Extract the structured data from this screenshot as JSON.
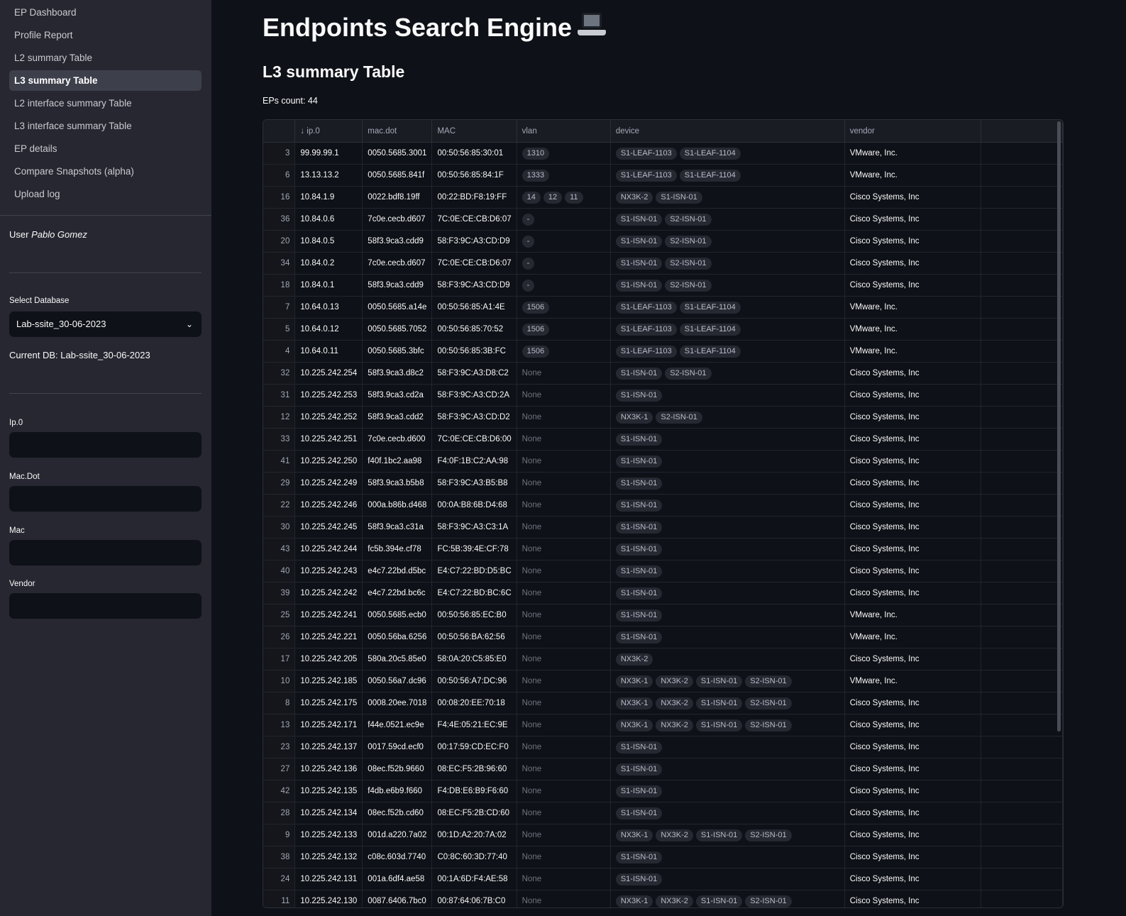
{
  "sidebar": {
    "nav": [
      {
        "label": "EP Dashboard",
        "active": false
      },
      {
        "label": "Profile Report",
        "active": false
      },
      {
        "label": "L2 summary Table",
        "active": false
      },
      {
        "label": "L3 summary Table",
        "active": true
      },
      {
        "label": "L2 interface summary Table",
        "active": false
      },
      {
        "label": "L3 interface summary Table",
        "active": false
      },
      {
        "label": "EP details",
        "active": false
      },
      {
        "label": "Compare Snapshots (alpha)",
        "active": false
      },
      {
        "label": "Upload log",
        "active": false
      }
    ],
    "user_prefix": "User ",
    "user_name": "Pablo Gomez",
    "select_db_label": "Select Database",
    "select_db_value": "Lab-ssite_30-06-2023",
    "current_db": "Current DB: Lab-ssite_30-06-2023",
    "filters": {
      "ip_label": "Ip.0",
      "macdot_label": "Mac.Dot",
      "mac_label": "Mac",
      "vendor_label": "Vendor"
    }
  },
  "main": {
    "title": "Endpoints Search Engine",
    "subtitle": "L3 summary Table",
    "count": "EPs count: 44"
  },
  "table": {
    "columns": [
      "",
      "↓ ip.0",
      "mac.dot",
      "MAC",
      "vlan",
      "device",
      "vendor",
      ""
    ],
    "rows": [
      {
        "idx": "3",
        "ip": "99.99.99.1",
        "macdot": "0050.5685.3001",
        "mac": "00:50:56:85:30:01",
        "vlan": [
          "1310"
        ],
        "device": [
          "S1-LEAF-1103",
          "S1-LEAF-1104"
        ],
        "vendor": "VMware, Inc."
      },
      {
        "idx": "6",
        "ip": "13.13.13.2",
        "macdot": "0050.5685.841f",
        "mac": "00:50:56:85:84:1F",
        "vlan": [
          "1333"
        ],
        "device": [
          "S1-LEAF-1103",
          "S1-LEAF-1104"
        ],
        "vendor": "VMware, Inc."
      },
      {
        "idx": "16",
        "ip": "10.84.1.9",
        "macdot": "0022.bdf8.19ff",
        "mac": "00:22:BD:F8:19:FF",
        "vlan": [
          "14",
          "12",
          "11"
        ],
        "device": [
          "NX3K-2",
          "S1-ISN-01"
        ],
        "vendor": "Cisco Systems, Inc"
      },
      {
        "idx": "36",
        "ip": "10.84.0.6",
        "macdot": "7c0e.cecb.d607",
        "mac": "7C:0E:CE:CB:D6:07",
        "vlan": [
          "-"
        ],
        "device": [
          "S1-ISN-01",
          "S2-ISN-01"
        ],
        "vendor": "Cisco Systems, Inc"
      },
      {
        "idx": "20",
        "ip": "10.84.0.5",
        "macdot": "58f3.9ca3.cdd9",
        "mac": "58:F3:9C:A3:CD:D9",
        "vlan": [
          "-"
        ],
        "device": [
          "S1-ISN-01",
          "S2-ISN-01"
        ],
        "vendor": "Cisco Systems, Inc"
      },
      {
        "idx": "34",
        "ip": "10.84.0.2",
        "macdot": "7c0e.cecb.d607",
        "mac": "7C:0E:CE:CB:D6:07",
        "vlan": [
          "-"
        ],
        "device": [
          "S1-ISN-01",
          "S2-ISN-01"
        ],
        "vendor": "Cisco Systems, Inc"
      },
      {
        "idx": "18",
        "ip": "10.84.0.1",
        "macdot": "58f3.9ca3.cdd9",
        "mac": "58:F3:9C:A3:CD:D9",
        "vlan": [
          "-"
        ],
        "device": [
          "S1-ISN-01",
          "S2-ISN-01"
        ],
        "vendor": "Cisco Systems, Inc"
      },
      {
        "idx": "7",
        "ip": "10.64.0.13",
        "macdot": "0050.5685.a14e",
        "mac": "00:50:56:85:A1:4E",
        "vlan": [
          "1506"
        ],
        "device": [
          "S1-LEAF-1103",
          "S1-LEAF-1104"
        ],
        "vendor": "VMware, Inc."
      },
      {
        "idx": "5",
        "ip": "10.64.0.12",
        "macdot": "0050.5685.7052",
        "mac": "00:50:56:85:70:52",
        "vlan": [
          "1506"
        ],
        "device": [
          "S1-LEAF-1103",
          "S1-LEAF-1104"
        ],
        "vendor": "VMware, Inc."
      },
      {
        "idx": "4",
        "ip": "10.64.0.11",
        "macdot": "0050.5685.3bfc",
        "mac": "00:50:56:85:3B:FC",
        "vlan": [
          "1506"
        ],
        "device": [
          "S1-LEAF-1103",
          "S1-LEAF-1104"
        ],
        "vendor": "VMware, Inc."
      },
      {
        "idx": "32",
        "ip": "10.225.242.254",
        "macdot": "58f3.9ca3.d8c2",
        "mac": "58:F3:9C:A3:D8:C2",
        "vlan": "None",
        "device": [
          "S1-ISN-01",
          "S2-ISN-01"
        ],
        "vendor": "Cisco Systems, Inc"
      },
      {
        "idx": "31",
        "ip": "10.225.242.253",
        "macdot": "58f3.9ca3.cd2a",
        "mac": "58:F3:9C:A3:CD:2A",
        "vlan": "None",
        "device": [
          "S1-ISN-01"
        ],
        "vendor": "Cisco Systems, Inc"
      },
      {
        "idx": "12",
        "ip": "10.225.242.252",
        "macdot": "58f3.9ca3.cdd2",
        "mac": "58:F3:9C:A3:CD:D2",
        "vlan": "None",
        "device": [
          "NX3K-1",
          "S2-ISN-01"
        ],
        "vendor": "Cisco Systems, Inc"
      },
      {
        "idx": "33",
        "ip": "10.225.242.251",
        "macdot": "7c0e.cecb.d600",
        "mac": "7C:0E:CE:CB:D6:00",
        "vlan": "None",
        "device": [
          "S1-ISN-01"
        ],
        "vendor": "Cisco Systems, Inc"
      },
      {
        "idx": "41",
        "ip": "10.225.242.250",
        "macdot": "f40f.1bc2.aa98",
        "mac": "F4:0F:1B:C2:AA:98",
        "vlan": "None",
        "device": [
          "S1-ISN-01"
        ],
        "vendor": "Cisco Systems, Inc"
      },
      {
        "idx": "29",
        "ip": "10.225.242.249",
        "macdot": "58f3.9ca3.b5b8",
        "mac": "58:F3:9C:A3:B5:B8",
        "vlan": "None",
        "device": [
          "S1-ISN-01"
        ],
        "vendor": "Cisco Systems, Inc"
      },
      {
        "idx": "22",
        "ip": "10.225.242.246",
        "macdot": "000a.b86b.d468",
        "mac": "00:0A:B8:6B:D4:68",
        "vlan": "None",
        "device": [
          "S1-ISN-01"
        ],
        "vendor": "Cisco Systems, Inc"
      },
      {
        "idx": "30",
        "ip": "10.225.242.245",
        "macdot": "58f3.9ca3.c31a",
        "mac": "58:F3:9C:A3:C3:1A",
        "vlan": "None",
        "device": [
          "S1-ISN-01"
        ],
        "vendor": "Cisco Systems, Inc"
      },
      {
        "idx": "43",
        "ip": "10.225.242.244",
        "macdot": "fc5b.394e.cf78",
        "mac": "FC:5B:39:4E:CF:78",
        "vlan": "None",
        "device": [
          "S1-ISN-01"
        ],
        "vendor": "Cisco Systems, Inc"
      },
      {
        "idx": "40",
        "ip": "10.225.242.243",
        "macdot": "e4c7.22bd.d5bc",
        "mac": "E4:C7:22:BD:D5:BC",
        "vlan": "None",
        "device": [
          "S1-ISN-01"
        ],
        "vendor": "Cisco Systems, Inc"
      },
      {
        "idx": "39",
        "ip": "10.225.242.242",
        "macdot": "e4c7.22bd.bc6c",
        "mac": "E4:C7:22:BD:BC:6C",
        "vlan": "None",
        "device": [
          "S1-ISN-01"
        ],
        "vendor": "Cisco Systems, Inc"
      },
      {
        "idx": "25",
        "ip": "10.225.242.241",
        "macdot": "0050.5685.ecb0",
        "mac": "00:50:56:85:EC:B0",
        "vlan": "None",
        "device": [
          "S1-ISN-01"
        ],
        "vendor": "VMware, Inc."
      },
      {
        "idx": "26",
        "ip": "10.225.242.221",
        "macdot": "0050.56ba.6256",
        "mac": "00:50:56:BA:62:56",
        "vlan": "None",
        "device": [
          "S1-ISN-01"
        ],
        "vendor": "VMware, Inc."
      },
      {
        "idx": "17",
        "ip": "10.225.242.205",
        "macdot": "580a.20c5.85e0",
        "mac": "58:0A:20:C5:85:E0",
        "vlan": "None",
        "device": [
          "NX3K-2"
        ],
        "vendor": "Cisco Systems, Inc"
      },
      {
        "idx": "10",
        "ip": "10.225.242.185",
        "macdot": "0050.56a7.dc96",
        "mac": "00:50:56:A7:DC:96",
        "vlan": "None",
        "device": [
          "NX3K-1",
          "NX3K-2",
          "S1-ISN-01",
          "S2-ISN-01"
        ],
        "vendor": "VMware, Inc."
      },
      {
        "idx": "8",
        "ip": "10.225.242.175",
        "macdot": "0008.20ee.7018",
        "mac": "00:08:20:EE:70:18",
        "vlan": "None",
        "device": [
          "NX3K-1",
          "NX3K-2",
          "S1-ISN-01",
          "S2-ISN-01"
        ],
        "vendor": "Cisco Systems, Inc"
      },
      {
        "idx": "13",
        "ip": "10.225.242.171",
        "macdot": "f44e.0521.ec9e",
        "mac": "F4:4E:05:21:EC:9E",
        "vlan": "None",
        "device": [
          "NX3K-1",
          "NX3K-2",
          "S1-ISN-01",
          "S2-ISN-01"
        ],
        "vendor": "Cisco Systems, Inc"
      },
      {
        "idx": "23",
        "ip": "10.225.242.137",
        "macdot": "0017.59cd.ecf0",
        "mac": "00:17:59:CD:EC:F0",
        "vlan": "None",
        "device": [
          "S1-ISN-01"
        ],
        "vendor": "Cisco Systems, Inc"
      },
      {
        "idx": "27",
        "ip": "10.225.242.136",
        "macdot": "08ec.f52b.9660",
        "mac": "08:EC:F5:2B:96:60",
        "vlan": "None",
        "device": [
          "S1-ISN-01"
        ],
        "vendor": "Cisco Systems, Inc"
      },
      {
        "idx": "42",
        "ip": "10.225.242.135",
        "macdot": "f4db.e6b9.f660",
        "mac": "F4:DB:E6:B9:F6:60",
        "vlan": "None",
        "device": [
          "S1-ISN-01"
        ],
        "vendor": "Cisco Systems, Inc"
      },
      {
        "idx": "28",
        "ip": "10.225.242.134",
        "macdot": "08ec.f52b.cd60",
        "mac": "08:EC:F5:2B:CD:60",
        "vlan": "None",
        "device": [
          "S1-ISN-01"
        ],
        "vendor": "Cisco Systems, Inc"
      },
      {
        "idx": "9",
        "ip": "10.225.242.133",
        "macdot": "001d.a220.7a02",
        "mac": "00:1D:A2:20:7A:02",
        "vlan": "None",
        "device": [
          "NX3K-1",
          "NX3K-2",
          "S1-ISN-01",
          "S2-ISN-01"
        ],
        "vendor": "Cisco Systems, Inc"
      },
      {
        "idx": "38",
        "ip": "10.225.242.132",
        "macdot": "c08c.603d.7740",
        "mac": "C0:8C:60:3D:77:40",
        "vlan": "None",
        "device": [
          "S1-ISN-01"
        ],
        "vendor": "Cisco Systems, Inc"
      },
      {
        "idx": "24",
        "ip": "10.225.242.131",
        "macdot": "001a.6df4.ae58",
        "mac": "00:1A:6D:F4:AE:58",
        "vlan": "None",
        "device": [
          "S1-ISN-01"
        ],
        "vendor": "Cisco Systems, Inc"
      },
      {
        "idx": "11",
        "ip": "10.225.242.130",
        "macdot": "0087.6406.7bc0",
        "mac": "00:87:64:06:7B:C0",
        "vlan": "None",
        "device": [
          "NX3K-1",
          "NX3K-2",
          "S1-ISN-01",
          "S2-ISN-01"
        ],
        "vendor": "Cisco Systems, Inc"
      }
    ]
  },
  "icons": {
    "laptop": "laptop-icon",
    "chevron": "chevron-down-icon"
  }
}
